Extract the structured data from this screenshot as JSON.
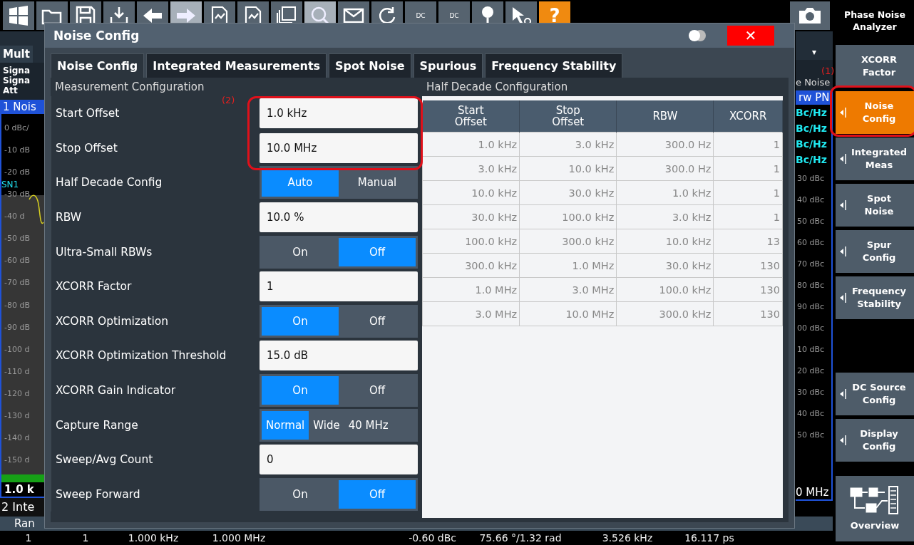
{
  "toolbar": {
    "buttons": [
      {
        "kind": "windows",
        "disabled": false
      },
      {
        "kind": "folder",
        "disabled": false
      },
      {
        "kind": "save",
        "disabled": false
      },
      {
        "kind": "export",
        "disabled": false
      },
      {
        "kind": "undo",
        "disabled": false
      },
      {
        "kind": "redo",
        "disabled": true
      },
      {
        "kind": "document",
        "disabled": false
      },
      {
        "kind": "document",
        "disabled": false
      },
      {
        "kind": "documents",
        "disabled": false
      },
      {
        "kind": "search",
        "disabled": true
      },
      {
        "kind": "envelope",
        "disabled": false
      },
      {
        "kind": "refresh",
        "disabled": false
      },
      {
        "kind": "text",
        "label": "DC",
        "disabled": false
      },
      {
        "kind": "text",
        "label": "DC",
        "disabled": false
      },
      {
        "kind": "marker",
        "disabled": false
      },
      {
        "kind": "pointer",
        "disabled": false
      },
      {
        "kind": "help",
        "label": "?",
        "disabled": false
      }
    ],
    "right_buttons": [
      {
        "kind": "camera",
        "disabled": false
      }
    ]
  },
  "main_view": {
    "tab": "Mult",
    "info": [
      "Signa",
      "Signa",
      "Att"
    ],
    "window_title": "1 Nois",
    "marker": "SN1",
    "y_labels": [
      "0 dBc/",
      "-10 dB",
      "-20 dB",
      "-30 dB",
      "-40 d",
      "-50 dB",
      "-60 dB",
      "-70 dB",
      "-80 dB",
      "-90 dB",
      "-100 d",
      "-110 d",
      "-120 d",
      "-130 d",
      "-140 d",
      "-150 d"
    ],
    "sweep_progress": {
      "level": 1
    },
    "x_start": "1.0 k",
    "results_title": "2 Inte",
    "results_header": "Ran",
    "right": {
      "dropdown": "▾",
      "header": "e Noise",
      "window_title": "rw PN",
      "readings": [
        "Bc/Hz",
        "Bc/Hz",
        "Bc/Hz",
        "Bc/Hz"
      ],
      "y_labels": [
        "30 dBc",
        "40 dBc",
        "50 dBc",
        "60 dBc",
        "70 dBc",
        "80 dBc",
        "90 dBc",
        "00 dBc",
        "10 dBc",
        "20 dBc",
        "30 dBc",
        "40 dBc",
        "50 dBc"
      ],
      "x_stop": "0 MHz"
    }
  },
  "results_row": [
    "1",
    "1",
    "1.000 kHz",
    "1.000 MHz",
    "-0.60 dBc",
    "75.66 °/1.32 rad",
    "3.526 kHz",
    "16.117 ps"
  ],
  "sidebar": {
    "title": "Phase Noise Analyzer",
    "annotation": "(1)",
    "groups": [
      [
        {
          "label": "XCORR\nFactor",
          "kind": "plain",
          "selected": false
        },
        {
          "label": "Noise\nConfig",
          "kind": "menu",
          "selected": true
        },
        {
          "label": "Integrated\nMeas",
          "kind": "menu",
          "selected": false
        },
        {
          "label": "Spot\nNoise",
          "kind": "menu",
          "selected": false
        },
        {
          "label": "Spur\nConfig",
          "kind": "menu",
          "selected": false
        },
        {
          "label": "Frequency\nStability",
          "kind": "menu",
          "selected": false
        }
      ],
      [
        {
          "label": "DC Source\nConfig",
          "kind": "menu",
          "selected": false
        },
        {
          "label": "Display\nConfig",
          "kind": "menu",
          "selected": false
        }
      ],
      [
        {
          "label": "Overview",
          "kind": "overview",
          "selected": false
        }
      ]
    ]
  },
  "dialog": {
    "title": "Noise Config",
    "close": "✕",
    "tabs": [
      {
        "label": "Noise Config",
        "selected": true
      },
      {
        "label": "Integrated Measurements",
        "selected": false
      },
      {
        "label": "Spot Noise",
        "selected": false
      },
      {
        "label": "Spurious",
        "selected": false
      },
      {
        "label": "Frequency Stability",
        "selected": false
      }
    ],
    "measurement": {
      "title": "Measurement Configuration",
      "annotation": "(2)",
      "rows": [
        {
          "label": "Start Offset",
          "kind": "field",
          "value": "1.0 kHz"
        },
        {
          "label": "Stop Offset",
          "kind": "field",
          "value": "10.0 MHz"
        },
        {
          "label": "Half Decade Config",
          "kind": "toggle",
          "options": [
            {
              "label": "Auto",
              "selected": true
            },
            {
              "label": "Manual",
              "selected": false
            }
          ]
        },
        {
          "label": "RBW",
          "kind": "field",
          "value": "10.0 %"
        },
        {
          "label": "Ultra-Small RBWs",
          "kind": "toggle",
          "options": [
            {
              "label": "On",
              "selected": false
            },
            {
              "label": "Off",
              "selected": true
            }
          ]
        },
        {
          "label": "XCORR Factor",
          "kind": "field",
          "value": "1"
        },
        {
          "label": "XCORR Optimization",
          "kind": "toggle",
          "options": [
            {
              "label": "On",
              "selected": true
            },
            {
              "label": "Off",
              "selected": false
            }
          ]
        },
        {
          "label": "XCORR Optimization Threshold",
          "kind": "field",
          "value": "15.0 dB"
        },
        {
          "label": "XCORR Gain Indicator",
          "kind": "toggle",
          "options": [
            {
              "label": "On",
              "selected": true
            },
            {
              "label": "Off",
              "selected": false
            }
          ]
        },
        {
          "label": "Capture Range",
          "kind": "toggle",
          "options": [
            {
              "label": "Normal",
              "selected": true
            },
            {
              "label": "Wide",
              "selected": false
            },
            {
              "label": "40 MHz",
              "selected": false
            }
          ]
        },
        {
          "label": "Sweep/Avg Count",
          "kind": "field",
          "value": "0"
        },
        {
          "label": "Sweep Forward",
          "kind": "toggle",
          "options": [
            {
              "label": "On",
              "selected": false
            },
            {
              "label": "Off",
              "selected": true
            }
          ]
        }
      ]
    },
    "half_decade": {
      "title": "Half Decade Configuration",
      "columns": [
        "Start\nOffset",
        "Stop\nOffset",
        "RBW",
        "XCORR"
      ],
      "rows": [
        [
          "1.0 kHz",
          "3.0 kHz",
          "300.0 Hz",
          "1"
        ],
        [
          "3.0 kHz",
          "10.0 kHz",
          "300.0 Hz",
          "1"
        ],
        [
          "10.0 kHz",
          "30.0 kHz",
          "1.0 kHz",
          "1"
        ],
        [
          "30.0 kHz",
          "100.0 kHz",
          "3.0 kHz",
          "1"
        ],
        [
          "100.0 kHz",
          "300.0 kHz",
          "10.0 kHz",
          "13"
        ],
        [
          "300.0 kHz",
          "1.0 MHz",
          "30.0 kHz",
          "130"
        ],
        [
          "1.0 MHz",
          "3.0 MHz",
          "100.0 kHz",
          "130"
        ],
        [
          "3.0 MHz",
          "10.0 MHz",
          "300.0 kHz",
          "130"
        ]
      ]
    }
  }
}
